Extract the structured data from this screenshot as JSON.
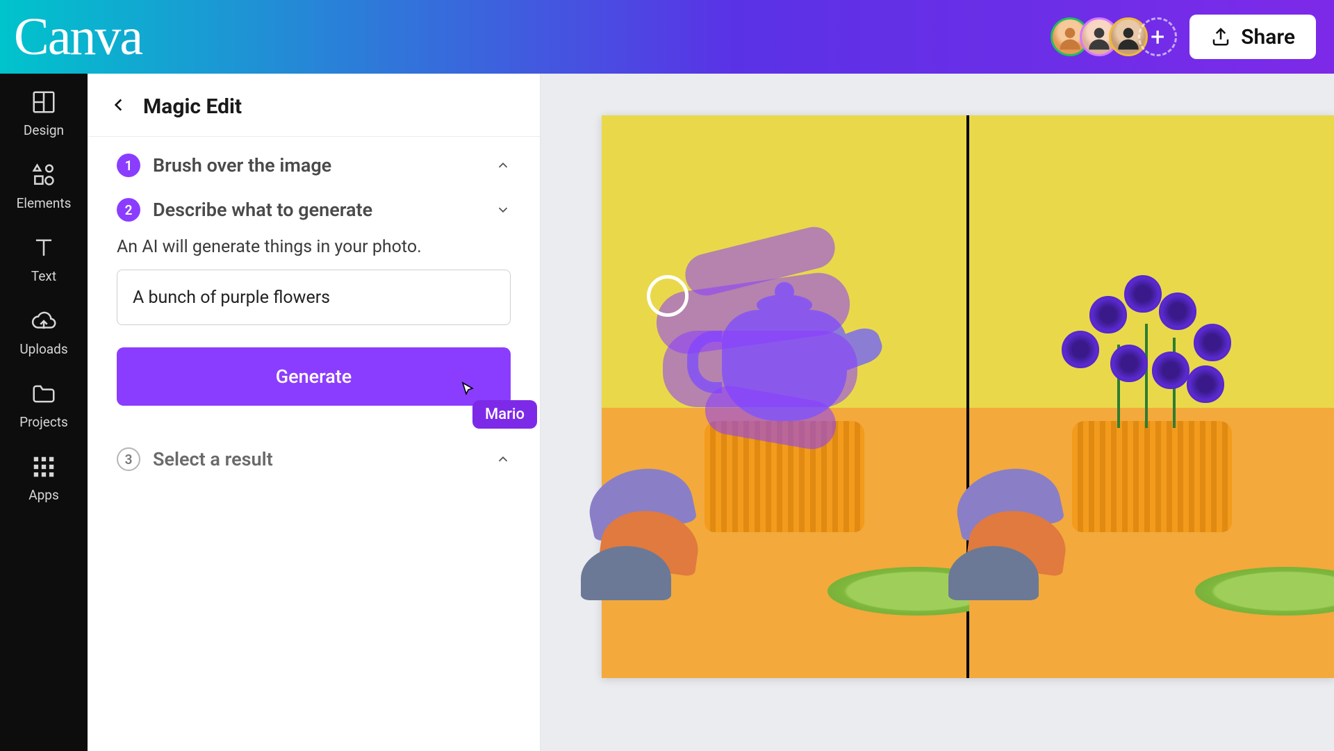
{
  "header": {
    "logo": "Canva",
    "share_label": "Share"
  },
  "nav": {
    "design": "Design",
    "elements": "Elements",
    "text": "Text",
    "uploads": "Uploads",
    "projects": "Projects",
    "apps": "Apps"
  },
  "panel": {
    "title": "Magic Edit",
    "step1": {
      "num": "1",
      "title": "Brush over the image"
    },
    "step2": {
      "num": "2",
      "title": "Describe what to generate",
      "desc": "An AI will generate things in your photo.",
      "input_value": "A bunch of purple flowers",
      "generate_label": "Generate"
    },
    "step3": {
      "num": "3",
      "title": "Select a result"
    }
  },
  "cursor": {
    "user": "Mario"
  },
  "colors": {
    "accent": "#8b3dff"
  }
}
